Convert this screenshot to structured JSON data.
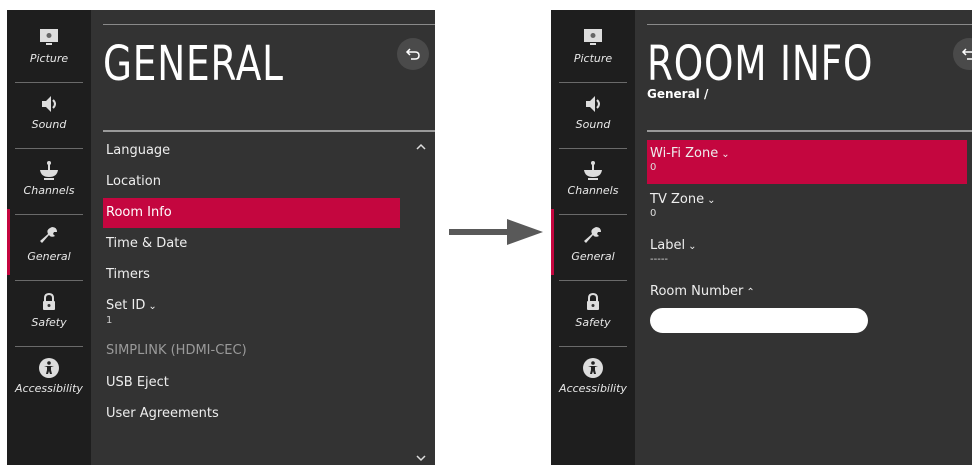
{
  "sidebar": {
    "items": [
      {
        "label": "Picture",
        "icon": "picture-icon"
      },
      {
        "label": "Sound",
        "icon": "speaker-icon"
      },
      {
        "label": "Channels",
        "icon": "satellite-dish-icon"
      },
      {
        "label": "General",
        "icon": "wrench-icon",
        "active": true
      },
      {
        "label": "Safety",
        "icon": "lock-icon"
      },
      {
        "label": "Accessibility",
        "icon": "accessibility-icon"
      }
    ]
  },
  "left_screen": {
    "title": "GENERAL",
    "menu": [
      {
        "label": "Language"
      },
      {
        "label": "Location"
      },
      {
        "label": "Room Info",
        "selected": true
      },
      {
        "label": "Time & Date"
      },
      {
        "label": "Timers"
      },
      {
        "label": "Set ID",
        "value": "1"
      },
      {
        "label": "SIMPLINK (HDMI-CEC)",
        "disabled": true
      },
      {
        "label": "USB Eject"
      },
      {
        "label": "User Agreements"
      }
    ]
  },
  "right_screen": {
    "title": "ROOM INFO",
    "breadcrumb": "General /",
    "fields": [
      {
        "label": "Wi-Fi Zone",
        "value": "0",
        "selected": true
      },
      {
        "label": "TV Zone",
        "value": "0"
      },
      {
        "label": "Label",
        "value": "-----"
      },
      {
        "label": "Room Number",
        "value": ""
      }
    ]
  },
  "colors": {
    "accent": "#c4063f",
    "panel_bg": "#333333",
    "sidebar_bg": "#1e1e1e"
  }
}
